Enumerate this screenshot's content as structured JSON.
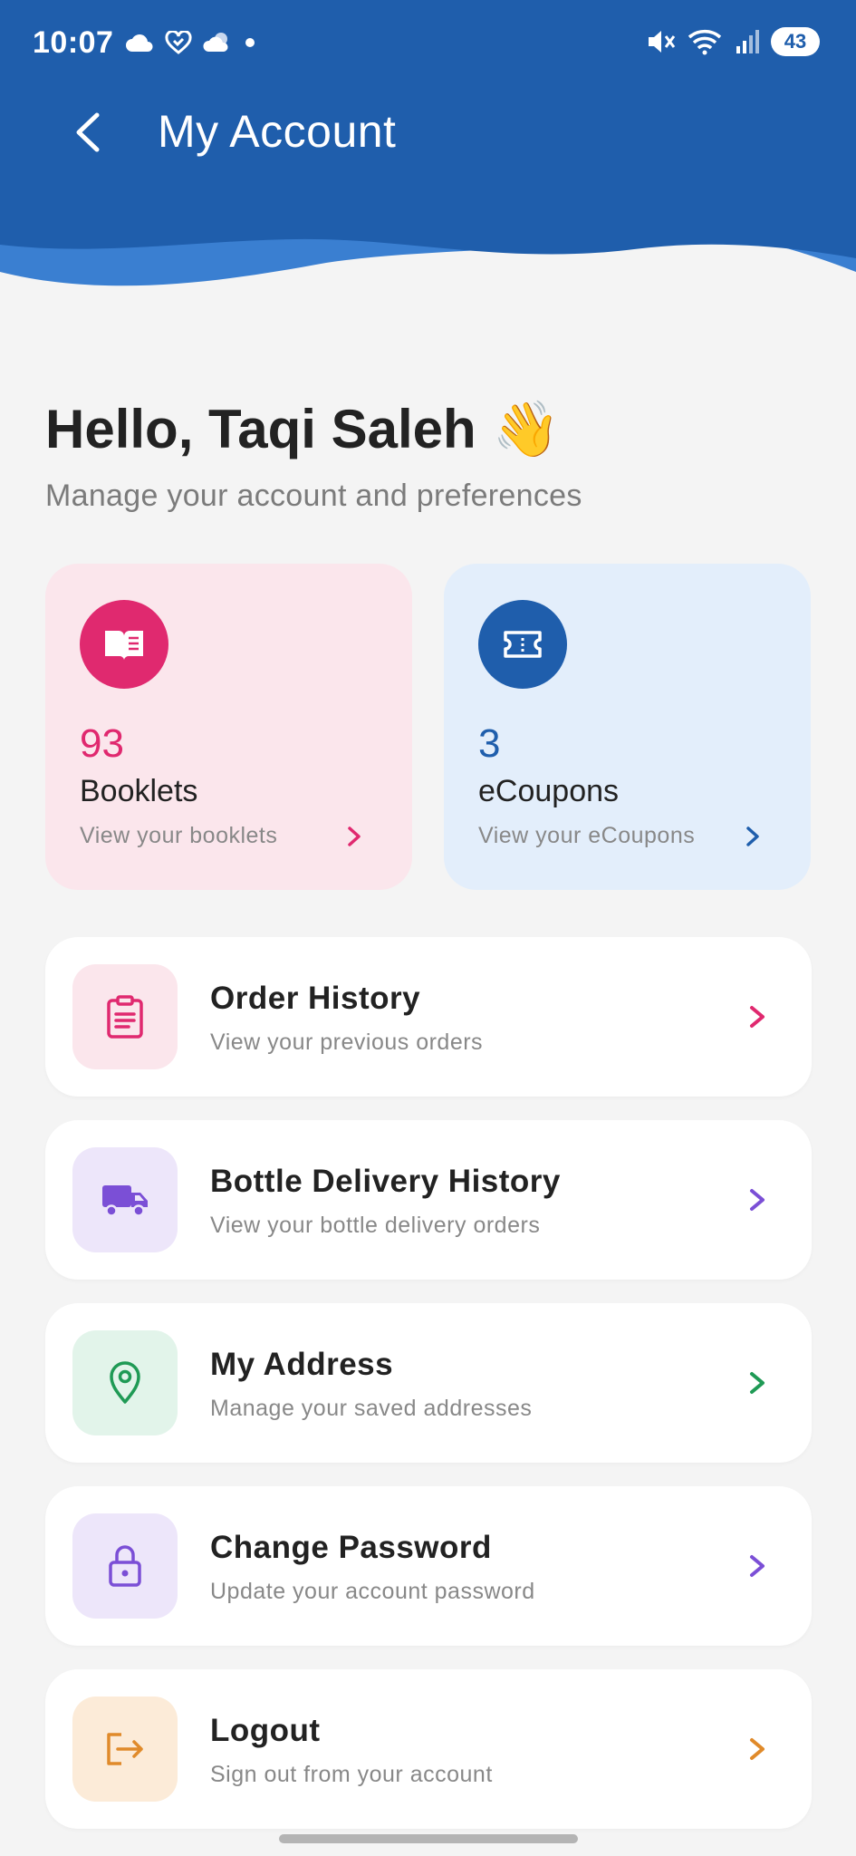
{
  "status_bar": {
    "time": "10:07",
    "battery": "43"
  },
  "appbar": {
    "title": "My Account"
  },
  "greeting": {
    "title": "Hello, Taqi Saleh",
    "emoji": "👋",
    "subtitle": "Manage your account and preferences"
  },
  "stats": [
    {
      "count": "93",
      "label": "Booklets",
      "link": "View your booklets",
      "icon": "book-icon",
      "accent": "#e0296f",
      "bg": "#fbe6ec"
    },
    {
      "count": "3",
      "label": "eCoupons",
      "link": "View your eCoupons",
      "icon": "ticket-icon",
      "accent": "#1f5eac",
      "bg": "#e3eefb"
    }
  ],
  "menu": [
    {
      "title": "Order History",
      "subtitle": "View your previous orders",
      "icon": "clipboard-icon",
      "accent": "#e0296f",
      "bg": "#fbe6ec"
    },
    {
      "title": "Bottle Delivery History",
      "subtitle": "View your bottle delivery orders",
      "icon": "truck-icon",
      "accent": "#7b4fd6",
      "bg": "#ede6fa"
    },
    {
      "title": "My Address",
      "subtitle": "Manage your saved addresses",
      "icon": "location-pin-icon",
      "accent": "#1f9a55",
      "bg": "#e2f4ea"
    },
    {
      "title": "Change Password",
      "subtitle": "Update your account password",
      "icon": "lock-icon",
      "accent": "#7b4fd6",
      "bg": "#ede6fa"
    },
    {
      "title": "Logout",
      "subtitle": "Sign out from your account",
      "icon": "logout-icon",
      "accent": "#e08a2a",
      "bg": "#fcebd8"
    }
  ],
  "colors": {
    "header_blue": "#1f5eac",
    "header_wave": "#3a7fd1",
    "page_bg": "#f4f4f4"
  }
}
